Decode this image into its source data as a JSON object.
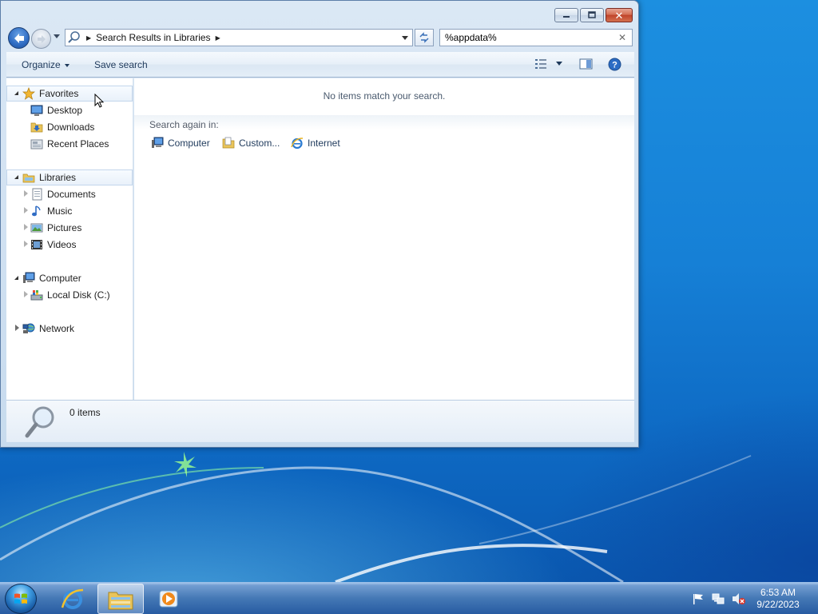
{
  "window": {
    "controls": [
      "minimize",
      "maximize",
      "close"
    ]
  },
  "nav": {
    "address_crumb": "Search Results in Libraries",
    "search_value": "%appdata%"
  },
  "toolbar": {
    "organize_label": "Organize",
    "save_search_label": "Save search"
  },
  "sidebar": {
    "favorites": {
      "header": "Favorites",
      "items": [
        {
          "label": "Desktop",
          "icon": "desktop-icon"
        },
        {
          "label": "Downloads",
          "icon": "downloads-folder-icon"
        },
        {
          "label": "Recent Places",
          "icon": "recent-places-icon"
        }
      ]
    },
    "libraries": {
      "header": "Libraries",
      "items": [
        {
          "label": "Documents",
          "icon": "documents-icon"
        },
        {
          "label": "Music",
          "icon": "music-icon"
        },
        {
          "label": "Pictures",
          "icon": "pictures-icon"
        },
        {
          "label": "Videos",
          "icon": "videos-icon"
        }
      ]
    },
    "computer": {
      "header": "Computer",
      "items": [
        {
          "label": "Local Disk (C:)",
          "icon": "local-disk-icon"
        }
      ]
    },
    "network": {
      "header": "Network"
    }
  },
  "content": {
    "empty_message": "No items match your search.",
    "search_again_label": "Search again in:",
    "search_again_links": [
      {
        "label": "Computer",
        "icon": "computer-icon"
      },
      {
        "label": "Custom...",
        "icon": "custom-folder-icon"
      },
      {
        "label": "Internet",
        "icon": "internet-explorer-icon"
      }
    ]
  },
  "details": {
    "count": "0 items"
  },
  "taskbar": {
    "clock_time": "6:53 AM",
    "clock_date": "9/22/2023"
  },
  "colors": {
    "accent": "#1e395b",
    "window_frame": "#cfe0f1",
    "desktop": "#1680d6"
  }
}
